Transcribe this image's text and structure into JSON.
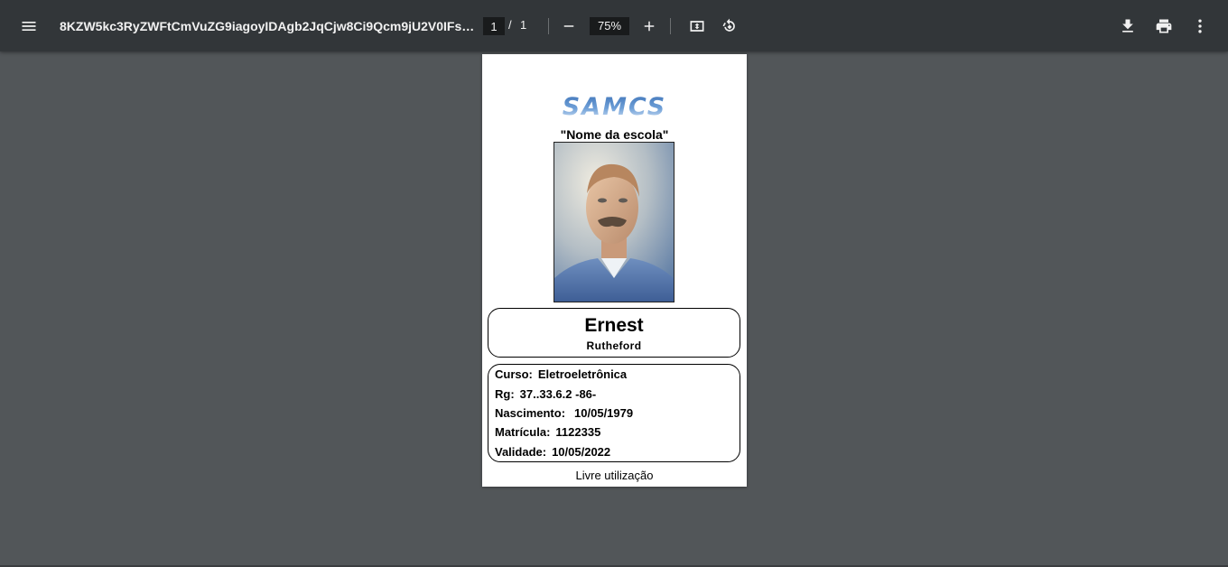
{
  "toolbar": {
    "title": "8KZW5kc3RyZWFtCmVuZG9iagoyIDAgb2JqCjw8Ci9Qcm9jU2V0IFsvU...",
    "page_current": "1",
    "page_separator": "/",
    "page_total": "1",
    "zoom": "75%",
    "icons": [
      "menu-icon",
      "zoom-out-icon",
      "zoom-in-icon",
      "fit-page-icon",
      "rotate-icon",
      "download-icon",
      "print-icon",
      "more-vert-icon"
    ]
  },
  "card": {
    "logo": "SAMCS",
    "school": "\"Nome da escola\"",
    "first_name": "Ernest",
    "last_name": "Rutheford",
    "fields": [
      {
        "label": "Curso:",
        "value": "Eletroeletrônica"
      },
      {
        "label": "Rg:",
        "value": "37..33.6.2 -86-"
      },
      {
        "label": "Nascimento:",
        "value": "10/05/1979"
      },
      {
        "label": "Matrícula:",
        "value": "1122335"
      },
      {
        "label": "Validade:",
        "value": "10/05/2022"
      }
    ],
    "footer": "Livre utilização"
  },
  "colors": {
    "toolbar_bg": "#323639",
    "viewer_bg": "#525659",
    "logo_blue": "#3f74b7"
  }
}
